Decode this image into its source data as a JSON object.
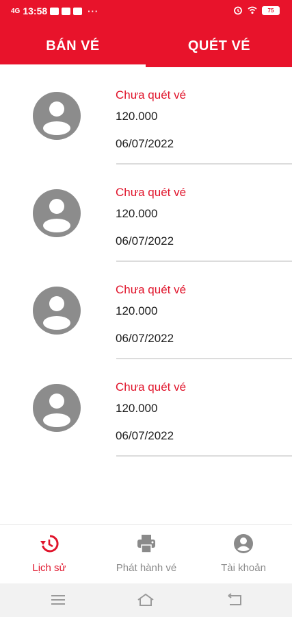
{
  "status_bar": {
    "time": "13:58",
    "signal": "4G",
    "more": "···",
    "battery": "75"
  },
  "tabs": [
    {
      "label": "BÁN VÉ",
      "active": true
    },
    {
      "label": "QUÉT VÉ",
      "active": false
    }
  ],
  "tickets": [
    {
      "status": "Chưa quét vé",
      "price": "120.000",
      "date": "06/07/2022"
    },
    {
      "status": "Chưa quét vé",
      "price": "120.000",
      "date": "06/07/2022"
    },
    {
      "status": "Chưa quét vé",
      "price": "120.000",
      "date": "06/07/2022"
    },
    {
      "status": "Chưa quét vé",
      "price": "120.000",
      "date": "06/07/2022"
    }
  ],
  "bottom_nav": {
    "history": "Lịch sử",
    "issue": "Phát hành vé",
    "account": "Tài khoản"
  },
  "colors": {
    "brand_red": "#e8132b",
    "status_red": "#e0142b",
    "inactive_gray": "#8a8a8a",
    "avatar_gray": "#8c8c8c"
  },
  "icons": {
    "history": "history-icon",
    "issue": "printer-icon",
    "account": "account-circle-icon"
  }
}
